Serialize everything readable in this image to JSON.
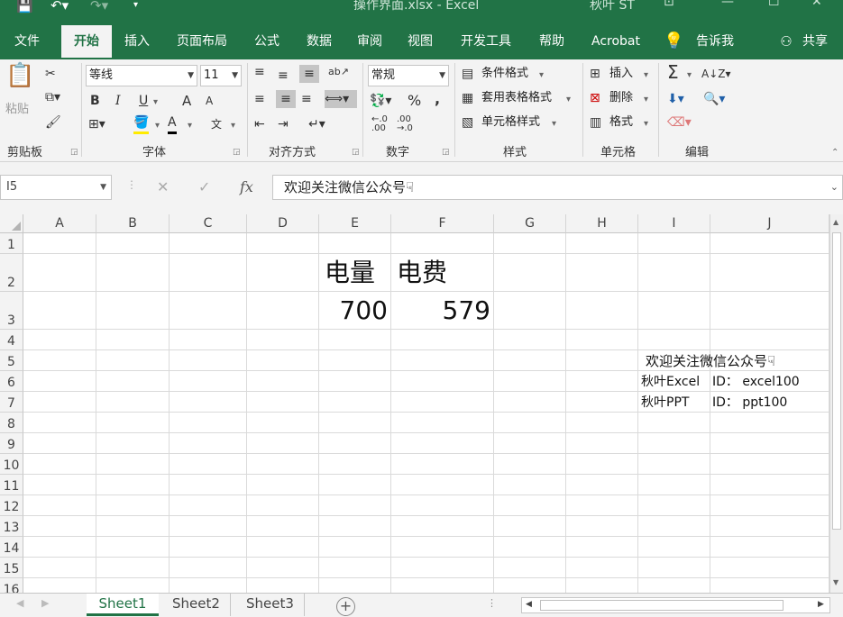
{
  "title_bar": {
    "filename": "操作界面.xlsx",
    "separator": "-",
    "app": "Excel",
    "user": "秋叶 ST"
  },
  "ribbon_tabs": [
    "文件",
    "开始",
    "插入",
    "页面布局",
    "公式",
    "数据",
    "审阅",
    "视图",
    "开发工具",
    "帮助",
    "Acrobat",
    "告诉我",
    "共享"
  ],
  "ribbon": {
    "clipboard": {
      "paste": "粘贴",
      "group": "剪贴板"
    },
    "font": {
      "name": "等线",
      "size": "11",
      "bold": "B",
      "italic": "I",
      "underline": "U",
      "grow": "A",
      "shrink": "A",
      "color": "A",
      "phonetic": "文",
      "group": "字体"
    },
    "alignment": {
      "group": "对齐方式"
    },
    "number": {
      "format": "常规",
      "percent": "%",
      "comma": ",",
      "group": "数字"
    },
    "styles": {
      "conditional": "条件格式",
      "table": "套用表格格式",
      "cell": "单元格样式",
      "group": "样式"
    },
    "cells": {
      "insert": "插入",
      "delete": "删除",
      "format": "格式",
      "group": "单元格"
    },
    "editing": {
      "sum": "Σ",
      "group": "编辑"
    }
  },
  "formula_bar": {
    "name_box": "I5",
    "fx": "fx",
    "content": "欢迎关注微信公众号☟"
  },
  "columns": [
    "A",
    "B",
    "C",
    "D",
    "E",
    "F",
    "G",
    "H",
    "I",
    "J"
  ],
  "rows": [
    "1",
    "2",
    "3",
    "4",
    "5",
    "6",
    "7",
    "8",
    "9",
    "10",
    "11",
    "12",
    "13",
    "14",
    "15",
    "16"
  ],
  "cells": {
    "E2": "电量",
    "F2": "电费",
    "E3": "700",
    "F3": "579",
    "I5": "欢迎关注微信公众号☟",
    "I6": "秋叶Excel",
    "J6": "ID： excel100",
    "I7": "秋叶PPT",
    "J7": "ID： ppt100"
  },
  "sheets": [
    "Sheet1",
    "Sheet2",
    "Sheet3"
  ],
  "add_sheet": "+",
  "colors": {
    "accent": "#217346"
  }
}
